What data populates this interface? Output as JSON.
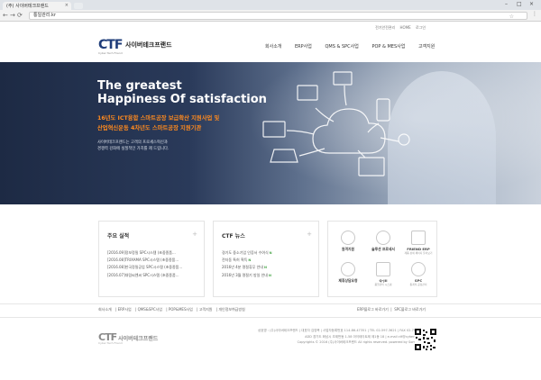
{
  "browser": {
    "tab_title": "(주) 사이버테크프랜드",
    "tab_close": "×",
    "url": "통일관리.kr",
    "window_controls": [
      "–",
      "□",
      "×"
    ],
    "nav": [
      "←",
      "→",
      "⟳",
      "⌂"
    ],
    "star_icon": "☆",
    "menu_icon": "⋮"
  },
  "header": {
    "top_links": [
      "전기안전관리",
      "HOME",
      "로그인"
    ],
    "logo_mark": "CTF",
    "logo_name": "사이버테크프랜드",
    "logo_tagline": "Cyber Tech Friend",
    "nav": [
      "회사소개",
      "ERP사업",
      "QMS & SPC사업",
      "POP & MES사업",
      "고객지원"
    ]
  },
  "hero": {
    "title_line1": "The greatest",
    "title_line2": "Happiness Of satisfaction",
    "sub_line1": "16년도 ICT융합 스마트공장 보급확산 지원사업 및",
    "sub_line2": "산업혁신운동 4차년도 스마트공장 지원기관",
    "desc_line1": "사이버테크프랜드는 고객의 프로세스혁신과",
    "desc_line2": "경쟁력 강화에 실질적인 가치를 제 드립니다."
  },
  "panels": {
    "results": {
      "title": "주요 실적",
      "more": "+",
      "items": [
        "[2016.09]정보정밀 SPC시스템 (초중종품...",
        "[2016.08]TRIXAMA SPC시스템 (초중종품...",
        "[2016.08]한국정밀공업 SPC시스템 (초중종품...",
        "[2016.07]대림씨엔씨 SPC시스템 (초중종품..."
      ]
    },
    "news": {
      "title": "CTF 뉴스",
      "more": "+",
      "new_badge": "N",
      "items": [
        "경기도 중소기업 인증서 수여식",
        "전자동 특허 획득",
        "2016년 4분 명절휴무 안내",
        "2016년 3월 명절기 방일 안내"
      ]
    },
    "services": [
      {
        "label": "원격지원",
        "sub": ""
      },
      {
        "label": "솔루션 프로세서",
        "sub": ""
      },
      {
        "label": "FRIEND ERP",
        "sub": "제품 상세 페이지 둘러보기"
      },
      {
        "label": "제휴상담요청",
        "sub": ""
      },
      {
        "label": "Q-JII",
        "sub": "품질관리 시스템"
      },
      {
        "label": "SPC",
        "sub": "통계적 공정관리"
      }
    ]
  },
  "footer": {
    "links": [
      "회사소개",
      "ERP사업",
      "QMS&SPC사업",
      "POP&MES사업",
      "고객지원",
      "개인정보취급방침"
    ],
    "right_links": [
      "ERP블로그 바로가기",
      "SPC블로그 바로가기"
    ],
    "logo_mark": "CTF",
    "logo_name": "사이버테크프랜드",
    "logo_tagline": "Cyber Tech Friend",
    "address_line1": "상호명 : (주)사이버테크프랜드 | 대표자 김영복 | 사업자등록번호 114-86-47351 | TEL 02-597-3621 | FAX 02-790-1365",
    "address_line2": "ADD 경기도 화남시 초제번동 1-58 아이테이트제 제1동 18 | e-mail ctf@cyberctf.co.kr",
    "copyright": "Copyrights © 2016 (주)사이버테크프랜드 All rights reserved. powered by Sombo INC."
  }
}
